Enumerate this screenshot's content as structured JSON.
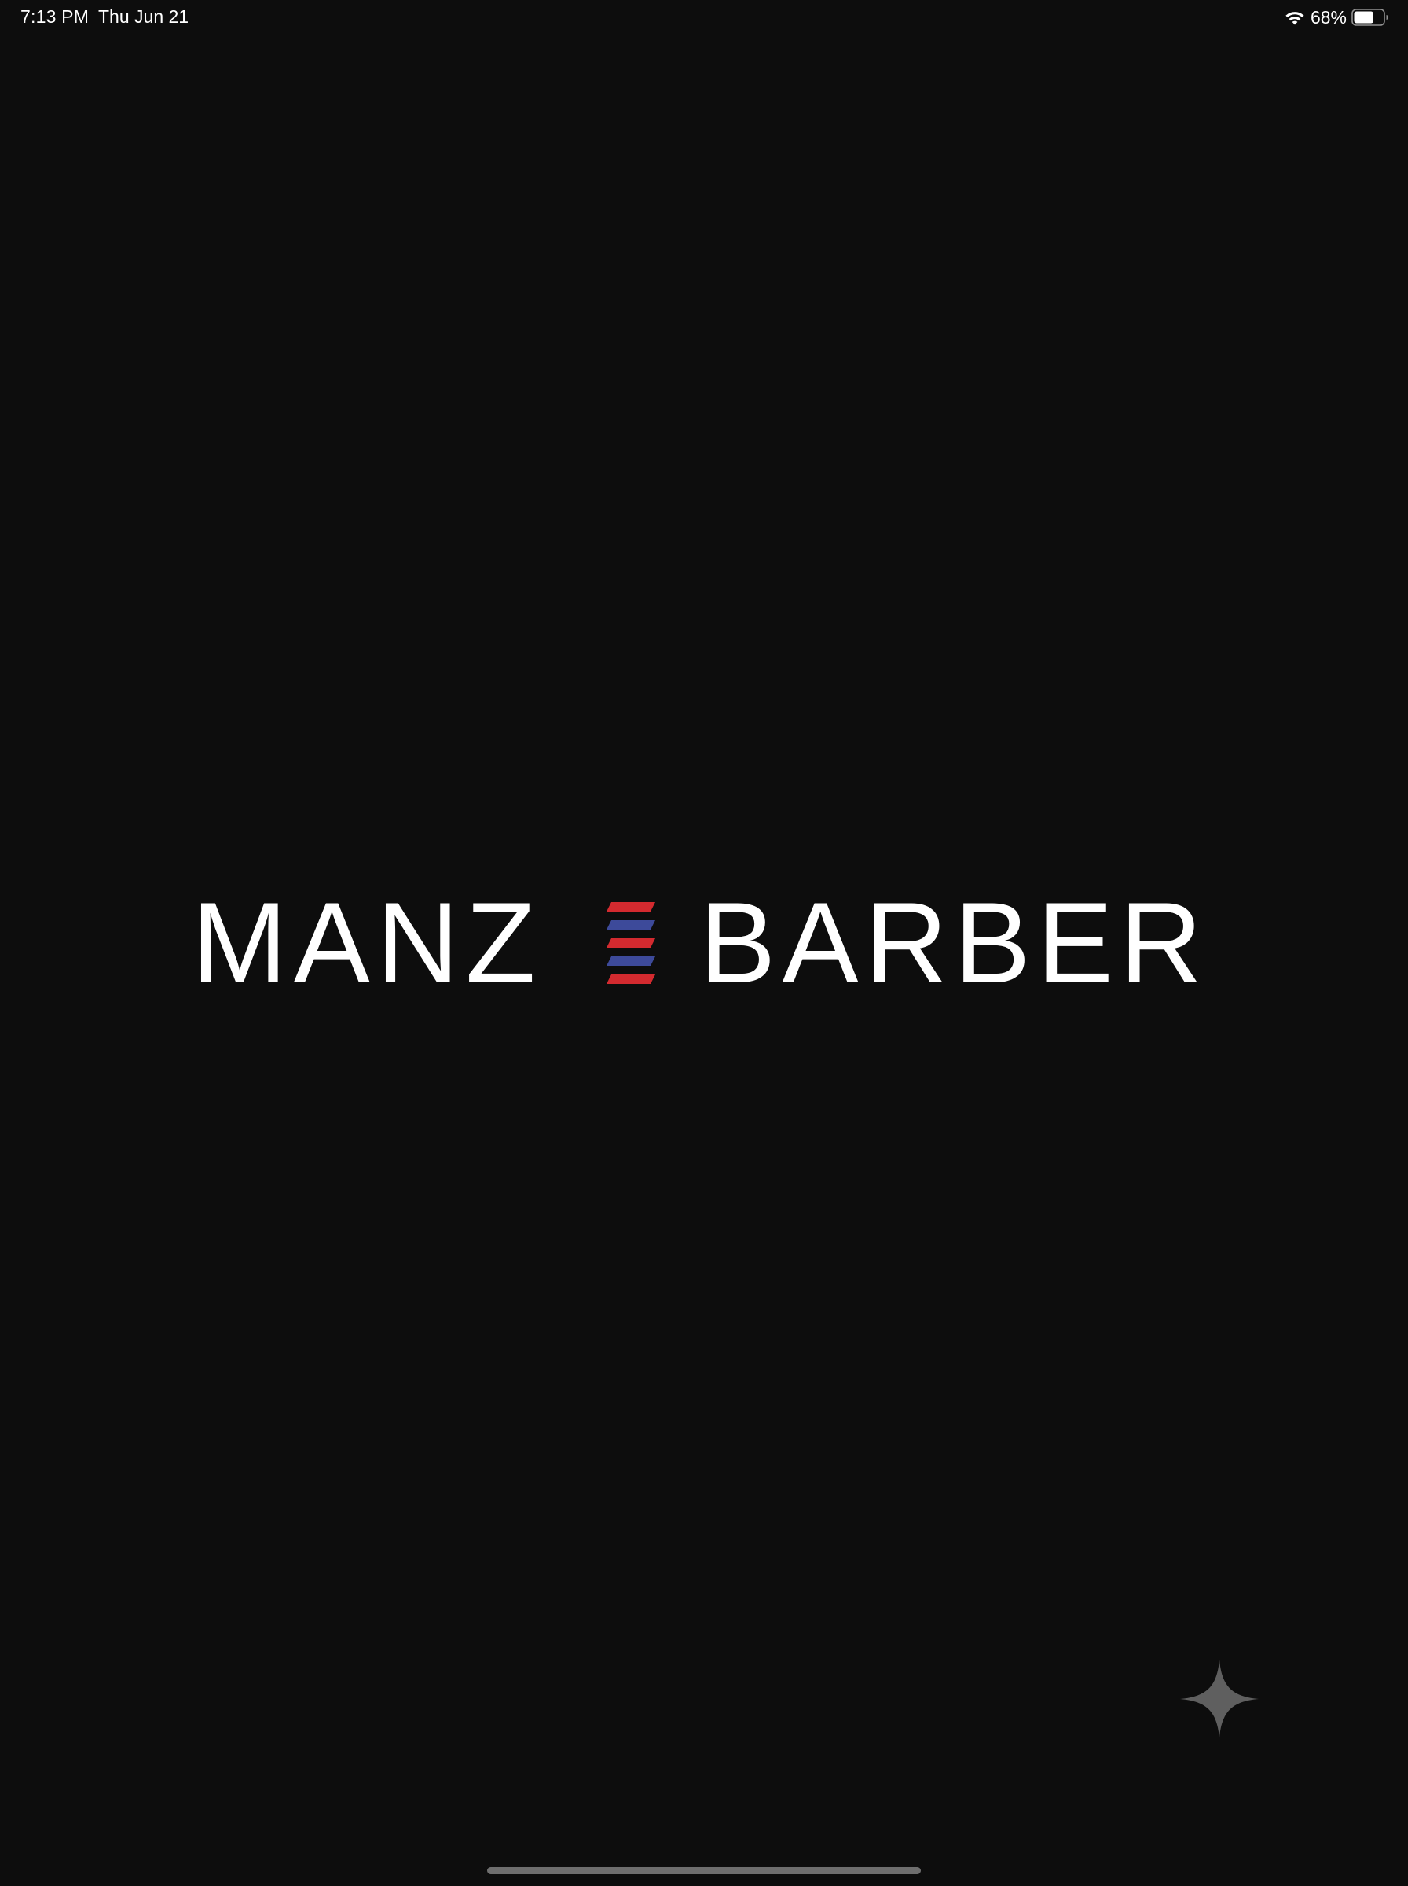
{
  "status_bar": {
    "time": "7:13 PM",
    "date": "Thu Jun 21",
    "battery_percent": "68%",
    "battery_level": 0.68,
    "wifi_icon": "wifi-icon",
    "battery_icon": "battery-icon"
  },
  "logo": {
    "word_left": "MANZ",
    "word_right": "BARBER",
    "pole_icon": "barber-pole-icon",
    "pole_colors": [
      "#d32a2f",
      "#3d4a9a",
      "#d32a2f",
      "#3d4a9a",
      "#d32a2f"
    ]
  },
  "floating": {
    "sparkle_icon": "sparkle-icon",
    "sparkle_color": "#5f5f5f"
  },
  "colors": {
    "background": "#0d0d0d",
    "text": "#ffffff",
    "home_indicator": "#6e6e6e"
  }
}
